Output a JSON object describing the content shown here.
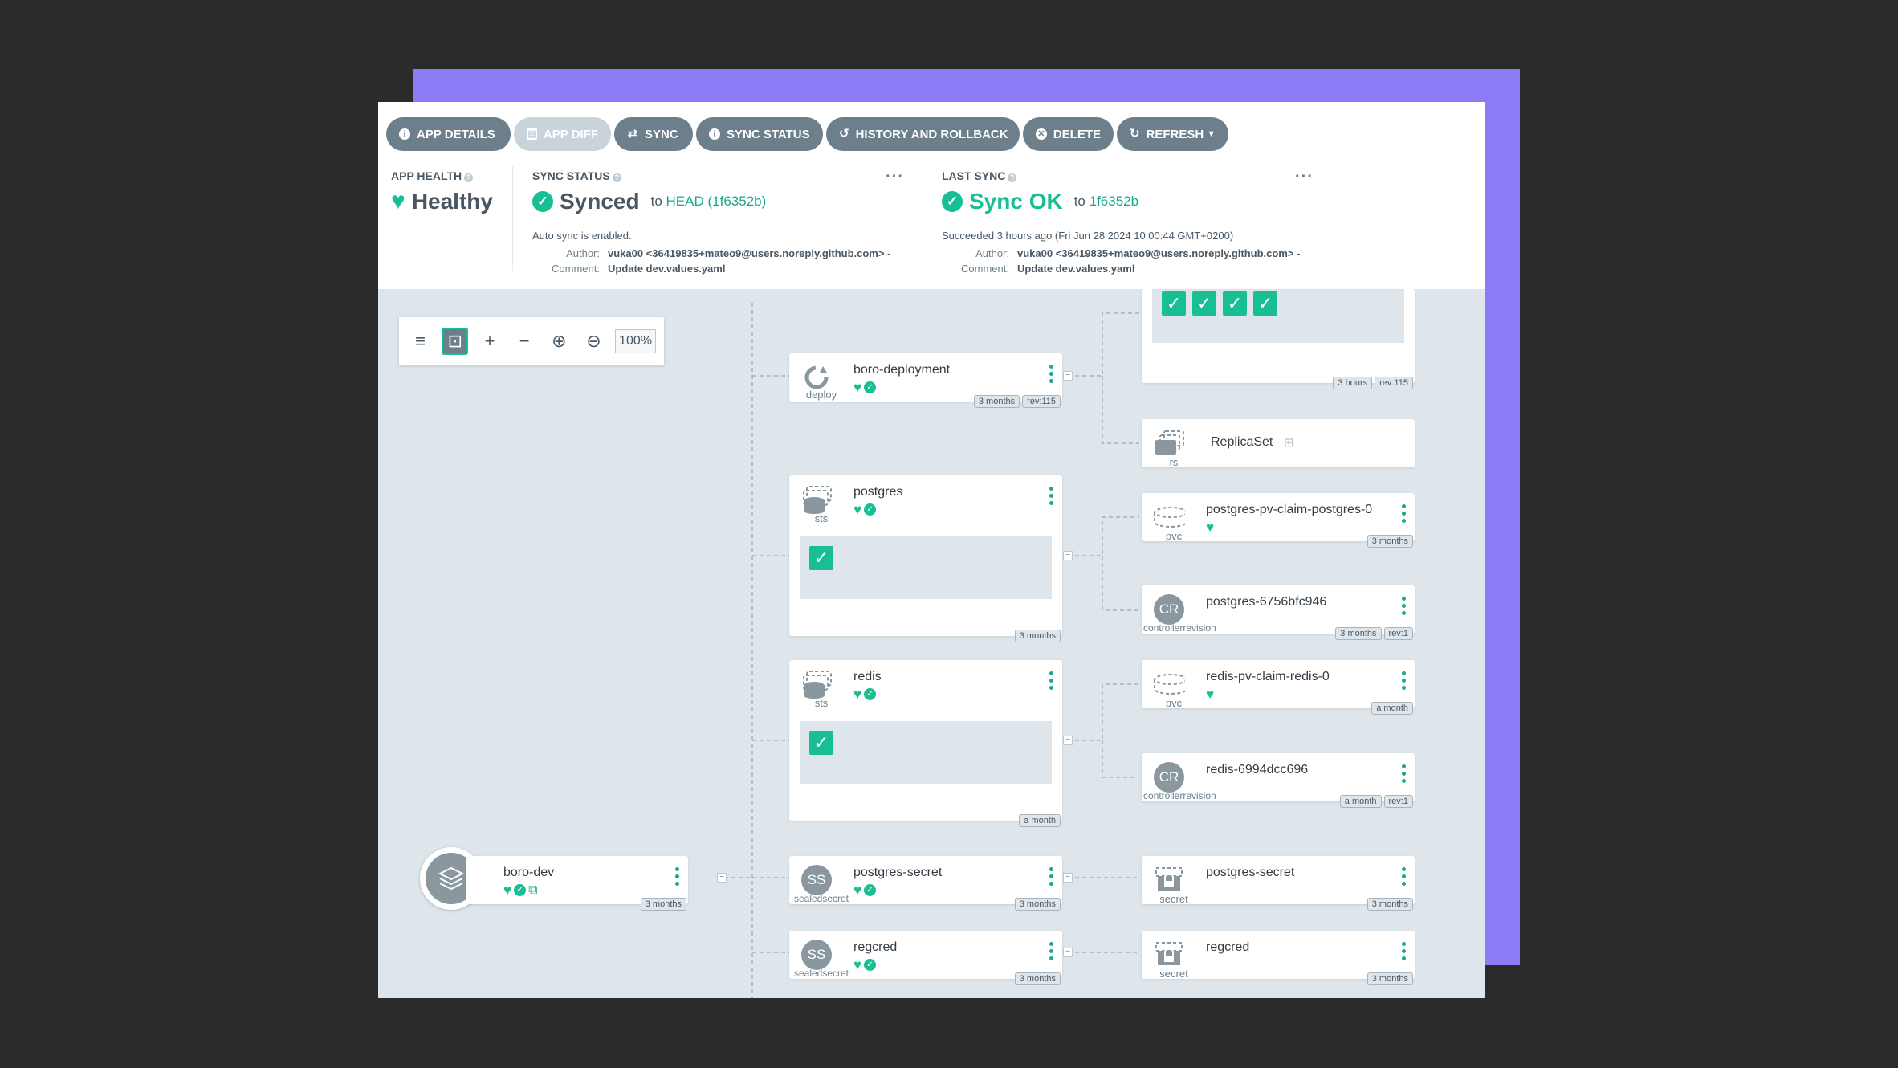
{
  "toolbar": {
    "app_details": "APP DETAILS",
    "app_diff": "APP DIFF",
    "sync": "SYNC",
    "sync_status": "SYNC STATUS",
    "history": "HISTORY AND ROLLBACK",
    "delete": "DELETE",
    "refresh": "REFRESH"
  },
  "health": {
    "title": "APP HEALTH",
    "value": "Healthy"
  },
  "sync_status": {
    "title": "SYNC STATUS",
    "value": "Synced",
    "to": "to",
    "target": "HEAD (1f6352b)",
    "auto": "Auto sync is enabled.",
    "author_label": "Author:",
    "author": "vuka00 <36419835+mateo9@users.noreply.github.com> -",
    "comment_label": "Comment:",
    "comment": "Update dev.values.yaml"
  },
  "last_sync": {
    "title": "LAST SYNC",
    "value": "Sync OK",
    "to": "to",
    "target": "1f6352b",
    "when": "Succeeded 3 hours ago (Fri Jun 28 2024 10:00:44 GMT+0200)",
    "author_label": "Author:",
    "author": "vuka00 <36419835+mateo9@users.noreply.github.com> -",
    "comment_label": "Comment:",
    "comment": "Update dev.values.yaml"
  },
  "zoom": {
    "value": "100%"
  },
  "nodes": {
    "app": {
      "name": "boro-dev",
      "age": "3 months"
    },
    "deploy": {
      "name": "boro-deployment",
      "type": "deploy",
      "age": "3 months",
      "rev": "rev:115"
    },
    "postgres": {
      "name": "postgres",
      "type": "sts",
      "age": "3 months"
    },
    "redis": {
      "name": "redis",
      "type": "sts",
      "age": "a month"
    },
    "pgsecret": {
      "name": "postgres-secret",
      "type": "sealedsecret",
      "badge": "SS",
      "age": "3 months"
    },
    "regcred": {
      "name": "regcred",
      "type": "sealedsecret",
      "badge": "SS",
      "age": "3 months"
    },
    "rs_top": {
      "age": "3 hours",
      "rev": "rev:115"
    },
    "replicaset": {
      "name": "ReplicaSet",
      "type": "rs"
    },
    "pvc_pg": {
      "name": "postgres-pv-claim-postgres-0",
      "type": "pvc",
      "age": "3 months"
    },
    "cr_pg": {
      "name": "postgres-6756bfc946",
      "type": "controllerrevision",
      "badge": "CR",
      "age": "3 months",
      "rev": "rev:1"
    },
    "pvc_redis": {
      "name": "redis-pv-claim-redis-0",
      "type": "pvc",
      "age": "a month"
    },
    "cr_redis": {
      "name": "redis-6994dcc696",
      "type": "controllerrevision",
      "badge": "CR",
      "age": "a month",
      "rev": "rev:1"
    },
    "secret_pg": {
      "name": "postgres-secret",
      "type": "secret",
      "age": "3 months"
    },
    "secret_reg": {
      "name": "regcred",
      "type": "secret",
      "age": "3 months"
    }
  },
  "colors": {
    "accent": "#18be94",
    "toolbar": "#6d7f8b",
    "purple": "#8b7cf6"
  }
}
